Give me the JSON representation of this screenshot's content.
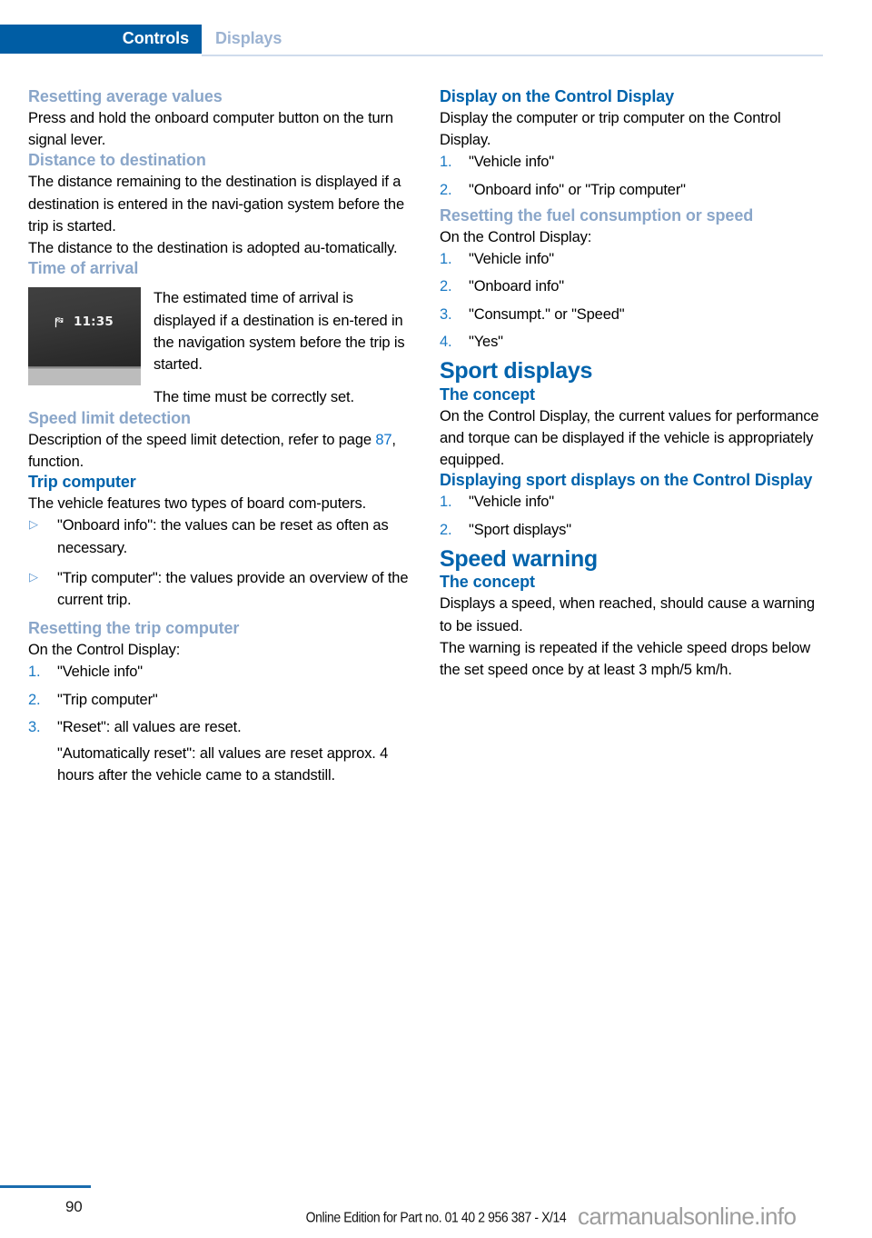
{
  "header": {
    "active_tab": "Controls",
    "inactive_tab": "Displays"
  },
  "colors": {
    "tab_blue": "#005da4",
    "heading_blue": "#0063ac",
    "subheading_light_blue": "#8aa6c9",
    "list_marker_blue": "#1b7ac4",
    "link_blue": "#0f73cb",
    "rule_blue": "#cfdcec",
    "footer_rule_blue": "#1a6cae"
  },
  "left_column": {
    "h_resetting_average_values": "Resetting average values",
    "p_resetting_average_values": "Press and hold the onboard computer button on the turn signal lever.",
    "h_distance_to_destination": "Distance to destination",
    "p_distance_1": "The distance remaining to the destination is displayed if a destination is entered in the navi‐gation system before the trip is started.",
    "p_distance_2": "The distance to the destination is adopted au‐tomatically.",
    "h_time_of_arrival": "Time of arrival",
    "figure": {
      "icon_name": "checkered-flag-icon",
      "time_value": "11:35"
    },
    "p_arrival_1": "The estimated time of arrival is displayed if a destination is en‐tered in the navigation system before the trip is started.",
    "p_arrival_2": "The time must be correctly set.",
    "h_speed_limit_detection": "Speed limit detection",
    "p_speed_limit_prefix": "Description of the speed limit detection, refer to page ",
    "p_speed_limit_page_ref": "87",
    "p_speed_limit_suffix": ", function.",
    "h_trip_computer": "Trip computer",
    "p_trip_computer_intro": "The vehicle features two types of board com‐puters.",
    "bullets_trip_computer": [
      "\"Onboard info\": the values can be reset as often as necessary.",
      "\"Trip computer\": the values provide an overview of the current trip."
    ],
    "h_resetting_trip_computer": "Resetting the trip computer",
    "p_resetting_trip_computer_intro": "On the Control Display:",
    "steps_resetting_trip_computer": [
      {
        "text": "\"Vehicle info\""
      },
      {
        "text": "\"Trip computer\""
      },
      {
        "text": "\"Reset\": all values are reset.",
        "continuation": "\"Automatically reset\": all values are reset approx. 4 hours after the vehicle came to a standstill."
      }
    ]
  },
  "right_column": {
    "h_display_on_control_display": "Display on the Control Display",
    "p_display_on_control_display": "Display the computer or trip computer on the Control Display.",
    "steps_display": [
      "\"Vehicle info\"",
      "\"Onboard info\" or \"Trip computer\""
    ],
    "h_resetting_fuel_consumption": "Resetting the fuel consumption or speed",
    "p_resetting_fuel_intro": "On the Control Display:",
    "steps_resetting_fuel": [
      "\"Vehicle info\"",
      "\"Onboard info\"",
      "\"Consumpt.\" or \"Speed\"",
      "\"Yes\""
    ],
    "h_sport_displays": "Sport displays",
    "h_sport_concept": "The concept",
    "p_sport_concept": "On the Control Display, the current values for performance and torque can be displayed if the vehicle is appropriately equipped.",
    "h_displaying_sport_displays": "Displaying sport displays on the Control Display",
    "steps_displaying_sport": [
      "\"Vehicle info\"",
      "\"Sport displays\""
    ],
    "h_speed_warning": "Speed warning",
    "h_speed_warning_concept": "The concept",
    "p_speed_warning_1": "Displays a speed, when reached, should cause a warning to be issued.",
    "p_speed_warning_2": "The warning is repeated if the vehicle speed drops below the set speed once by at least 3 mph/5 km/h."
  },
  "footer": {
    "page_number": "90",
    "edition_text": "Online Edition for Part no. 01 40 2 956 387 - X/14",
    "watermark": "carmanualsonline.info"
  }
}
